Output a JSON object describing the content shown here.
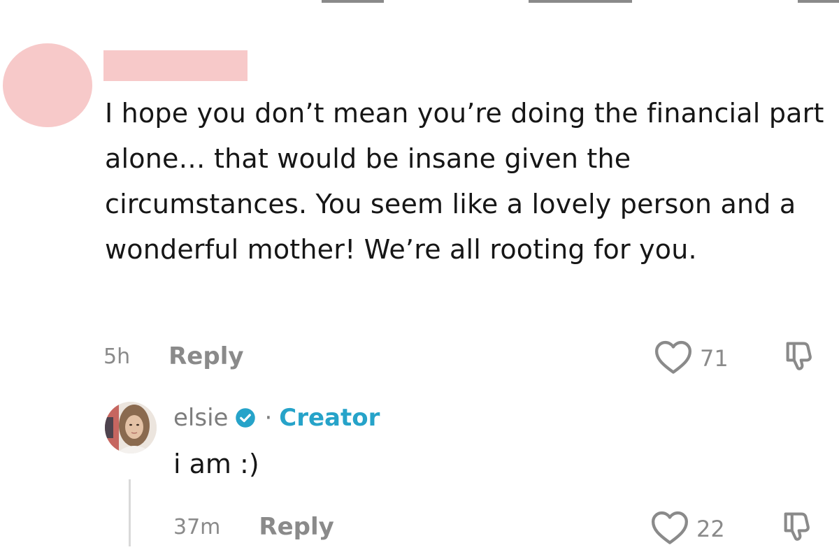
{
  "comment": {
    "text": "I hope you don’t mean you’re doing the financial part alone… that would be insane given the circumstances. You seem like a lovely person and a wonderful mother! We’re all rooting for you.",
    "time": "5h",
    "reply_label": "Reply",
    "likes": "71",
    "redaction_color": "#f7c9c9"
  },
  "reply": {
    "username": "elsie",
    "separator": "·",
    "badge": "Creator",
    "text": "i am :)",
    "time": "37m",
    "reply_label": "Reply",
    "likes": "22",
    "badge_color": "#26a3c9"
  },
  "icons": {
    "like": "heart-outline-icon",
    "dislike": "thumbs-down-icon",
    "verified": "verified-check-icon"
  }
}
